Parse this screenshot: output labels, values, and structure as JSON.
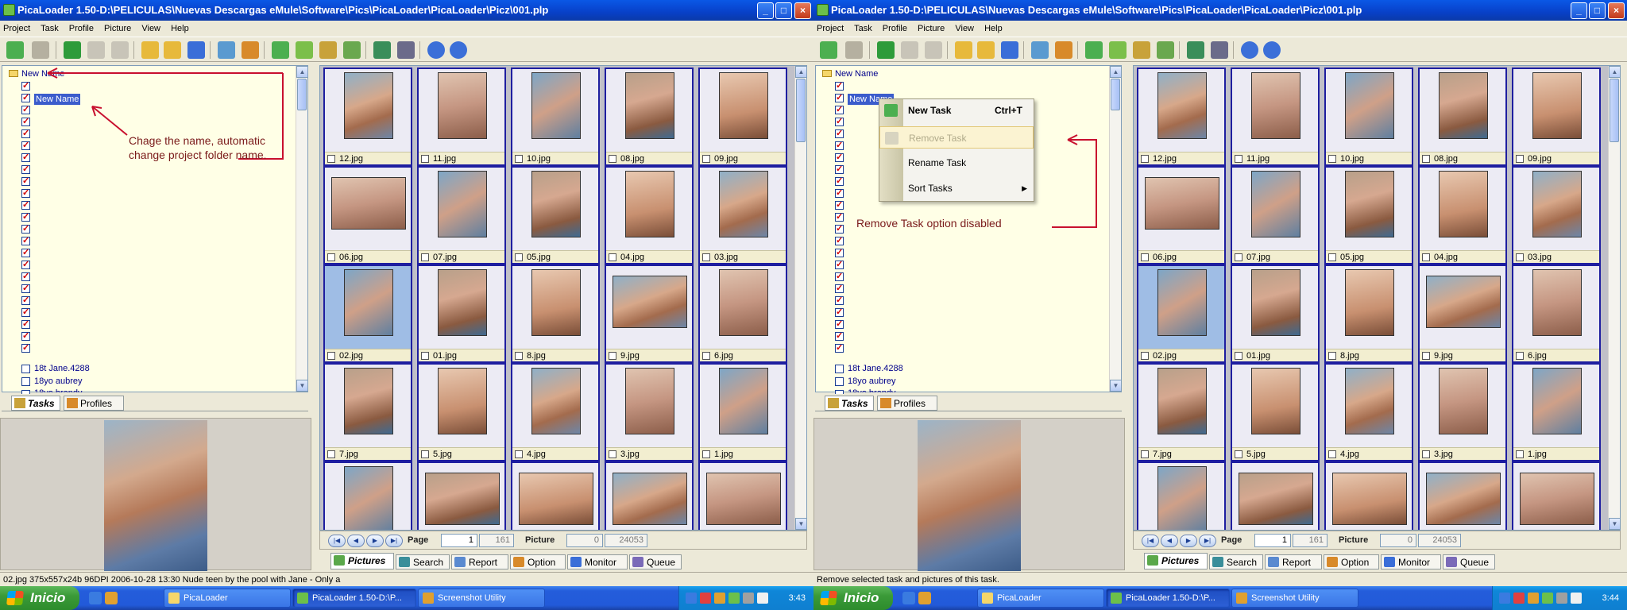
{
  "window": {
    "title": "PicaLoader 1.50-D:\\PELICULAS\\Nuevas Descargas eMule\\Software\\Pics\\PicaLoader\\PicaLoader\\Picz\\001.plp",
    "minimize": "_",
    "maximize": "□",
    "close": "×"
  },
  "menu": [
    "Project",
    "Task",
    "Profile",
    "Picture",
    "View",
    "Help"
  ],
  "tree": {
    "root_label": "New Name",
    "editing_label": "New Name",
    "extra_items": [
      "18t Jane.4288",
      "18yo aubrey",
      "18yo brandy"
    ]
  },
  "left_tabs": [
    "Tasks",
    "Profiles"
  ],
  "thumbnails": [
    [
      "12.jpg",
      "11.jpg",
      "10.jpg",
      "08.jpg",
      "09.jpg"
    ],
    [
      "06.jpg",
      "07.jpg",
      "05.jpg",
      "04.jpg",
      "03.jpg"
    ],
    [
      "02.jpg",
      "01.jpg",
      "8.jpg",
      "9.jpg",
      "6.jpg"
    ],
    [
      "7.jpg",
      "5.jpg",
      "4.jpg",
      "3.jpg",
      "1.jpg"
    ]
  ],
  "pager": {
    "page_label": "Page",
    "page_value": "1",
    "page_total": "161",
    "picture_label": "Picture",
    "picture_value": "0",
    "picture_total": "24053"
  },
  "right_tabs": [
    "Pictures",
    "Search",
    "Report",
    "Option",
    "Monitor",
    "Queue"
  ],
  "status": {
    "left": "02.jpg 375x557x24b 96DPI 2006-10-28 13:30 Nude teen by the pool with Jane - Only a",
    "right": "Remove selected task and pictures of this task."
  },
  "annotations": {
    "left": "Chage the name, automatic change project folder name.",
    "right": "Remove Task option disabled"
  },
  "context_menu": {
    "items": [
      {
        "label": "New Task",
        "shortcut": "Ctrl+T"
      },
      {
        "label": "Remove Task",
        "shortcut": ""
      },
      {
        "label": "Rename Task",
        "shortcut": ""
      },
      {
        "label": "Sort Tasks",
        "shortcut": ""
      }
    ]
  },
  "taskbar": {
    "start": "Inicio",
    "tasks": [
      "PicaLoader",
      "PicaLoader 1.50-D:\\P...",
      "Screenshot Utility"
    ],
    "clock_left": "3:43",
    "clock_right": "3:44"
  }
}
